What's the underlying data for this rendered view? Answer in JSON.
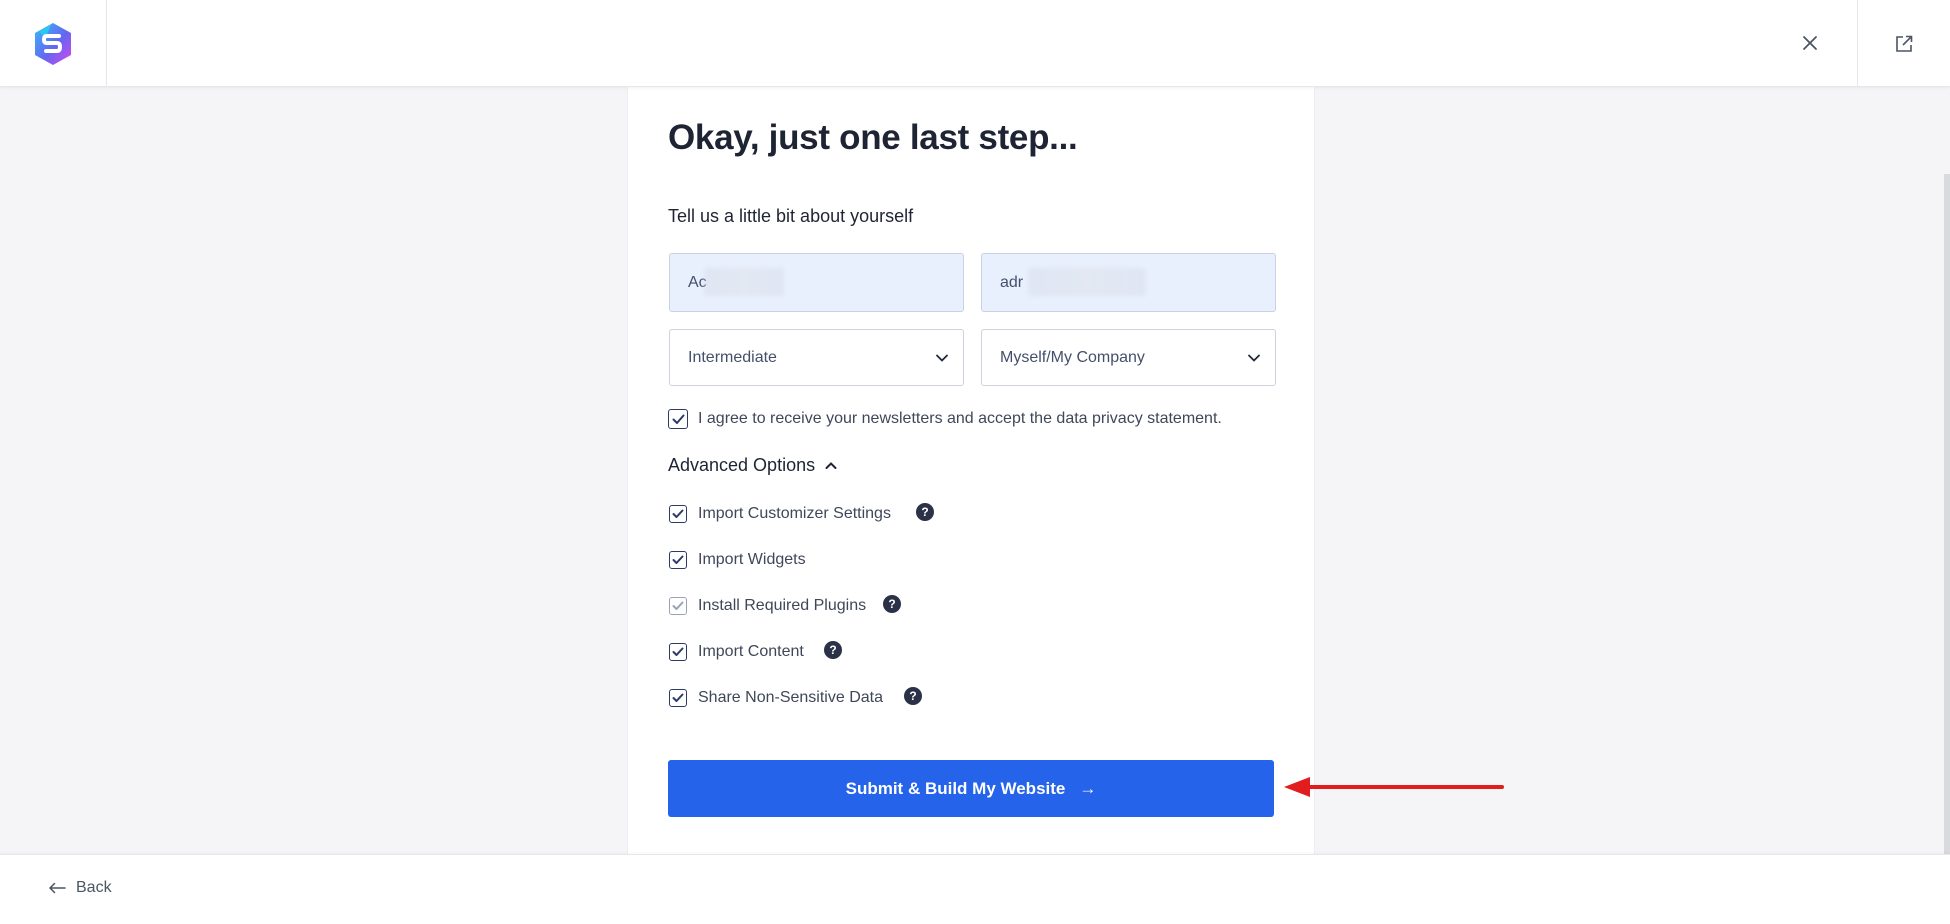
{
  "header": {
    "logo_icon": "starter-templates-logo",
    "close_icon": "close-icon",
    "external_icon": "external-link-icon"
  },
  "form": {
    "heading": "Okay, just one last step...",
    "subheading": "Tell us a little bit about yourself",
    "first_field_value": "Ac",
    "second_field_value": "adr",
    "experience_select": "Intermediate",
    "purpose_select": "Myself/My Company",
    "newsletter_label": "I agree to receive your newsletters and accept the data privacy statement.",
    "advanced_label": "Advanced Options",
    "options": [
      {
        "label": "Import Customizer Settings",
        "checked": true,
        "help": true
      },
      {
        "label": "Import Widgets",
        "checked": true,
        "help": false
      },
      {
        "label": "Install Required Plugins",
        "checked": true,
        "disabled": true,
        "help": true
      },
      {
        "label": "Import Content",
        "checked": true,
        "help": true
      },
      {
        "label": "Share Non-Sensitive Data",
        "checked": true,
        "help": true
      }
    ],
    "help_glyph": "?",
    "submit_label": "Submit & Build My Website",
    "submit_arrow": "→"
  },
  "footer": {
    "back_label": "Back"
  },
  "colors": {
    "primary": "#2563eb",
    "annotation_arrow": "#e11d1d",
    "background": "#f5f5f7"
  }
}
